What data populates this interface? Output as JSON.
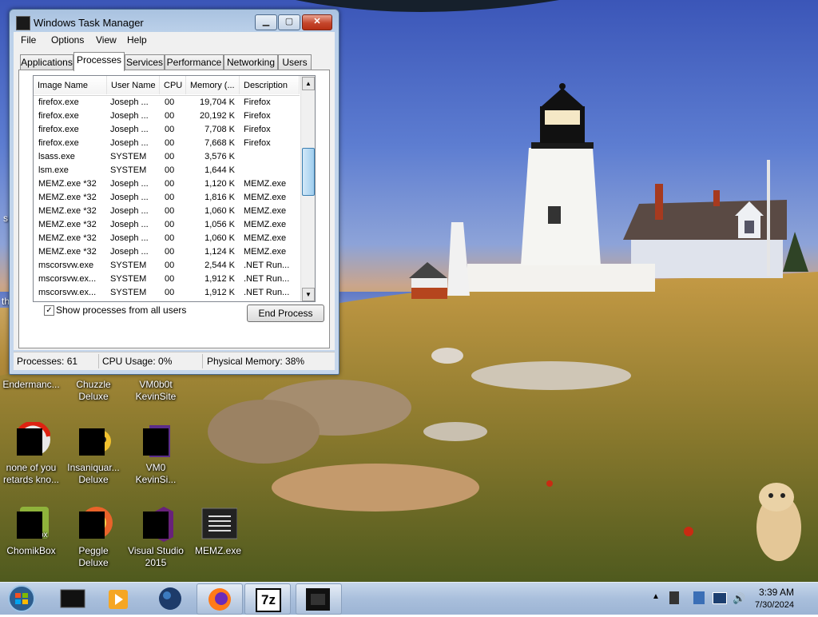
{
  "window": {
    "title": "Windows Task Manager",
    "menu": [
      "File",
      "Options",
      "View",
      "Help"
    ],
    "tabs": [
      "Applications",
      "Processes",
      "Services",
      "Performance",
      "Networking",
      "Users"
    ],
    "active_tab": "Processes",
    "columns": [
      "Image Name",
      "User Name",
      "CPU",
      "Memory (...",
      "Description"
    ],
    "processes": [
      {
        "name": "firefox.exe",
        "user": "Joseph ...",
        "cpu": "00",
        "mem": "19,704 K",
        "desc": "Firefox"
      },
      {
        "name": "firefox.exe",
        "user": "Joseph ...",
        "cpu": "00",
        "mem": "20,192 K",
        "desc": "Firefox"
      },
      {
        "name": "firefox.exe",
        "user": "Joseph ...",
        "cpu": "00",
        "mem": "7,708 K",
        "desc": "Firefox"
      },
      {
        "name": "firefox.exe",
        "user": "Joseph ...",
        "cpu": "00",
        "mem": "7,668 K",
        "desc": "Firefox"
      },
      {
        "name": "lsass.exe",
        "user": "SYSTEM",
        "cpu": "00",
        "mem": "3,576 K",
        "desc": ""
      },
      {
        "name": "lsm.exe",
        "user": "SYSTEM",
        "cpu": "00",
        "mem": "1,644 K",
        "desc": ""
      },
      {
        "name": "MEMZ.exe *32",
        "user": "Joseph ...",
        "cpu": "00",
        "mem": "1,120 K",
        "desc": "MEMZ.exe"
      },
      {
        "name": "MEMZ.exe *32",
        "user": "Joseph ...",
        "cpu": "00",
        "mem": "1,816 K",
        "desc": "MEMZ.exe"
      },
      {
        "name": "MEMZ.exe *32",
        "user": "Joseph ...",
        "cpu": "00",
        "mem": "1,060 K",
        "desc": "MEMZ.exe"
      },
      {
        "name": "MEMZ.exe *32",
        "user": "Joseph ...",
        "cpu": "00",
        "mem": "1,056 K",
        "desc": "MEMZ.exe"
      },
      {
        "name": "MEMZ.exe *32",
        "user": "Joseph ...",
        "cpu": "00",
        "mem": "1,060 K",
        "desc": "MEMZ.exe"
      },
      {
        "name": "MEMZ.exe *32",
        "user": "Joseph ...",
        "cpu": "00",
        "mem": "1,124 K",
        "desc": "MEMZ.exe"
      },
      {
        "name": "mscorsvw.exe",
        "user": "SYSTEM",
        "cpu": "00",
        "mem": "2,544 K",
        "desc": ".NET Run..."
      },
      {
        "name": "mscorsvw.ex...",
        "user": "SYSTEM",
        "cpu": "00",
        "mem": "1,912 K",
        "desc": ".NET Run..."
      },
      {
        "name": "mscorsvw.ex...",
        "user": "SYSTEM",
        "cpu": "00",
        "mem": "1,912 K",
        "desc": ".NET Run..."
      }
    ],
    "show_all_label": "Show processes from all users",
    "show_all_checked": true,
    "end_process_label": "End Process",
    "status": {
      "processes": "Processes: 61",
      "cpu": "CPU Usage: 0%",
      "memory": "Physical Memory: 38%"
    }
  },
  "desktop_icons": [
    {
      "label": "Endermanc...",
      "icon": "app-icon"
    },
    {
      "label": "Chuzzle Deluxe",
      "icon": "game-icon"
    },
    {
      "label": "VM0b0t KevinSite",
      "icon": "app-icon"
    },
    {
      "label": "none of you retards kno...",
      "icon": "file-icon"
    },
    {
      "label": "Insaniquar... Deluxe",
      "icon": "game-icon"
    },
    {
      "label": "VM0 KevinSi...",
      "icon": "app-icon"
    },
    {
      "label": "ChomikBox",
      "icon": "app-icon"
    },
    {
      "label": "Peggle Deluxe",
      "icon": "game-icon"
    },
    {
      "label": "Visual Studio 2015",
      "icon": "visual-studio-icon"
    },
    {
      "label": "MEMZ.exe",
      "icon": "exe-icon"
    }
  ],
  "edge_text": {
    "left1": "s",
    "left2": "th"
  },
  "taskbar": {
    "pinned": [
      "start-orb-icon",
      "terminal-icon",
      "media-player-icon",
      "globe-icon",
      "firefox-icon",
      "7zip-icon",
      "memz-window-icon"
    ],
    "seven_zip": "7z",
    "clock_time": "3:39 AM",
    "clock_date": "7/30/2024"
  }
}
